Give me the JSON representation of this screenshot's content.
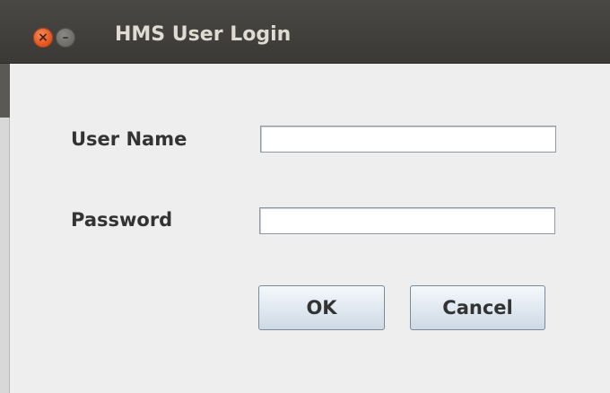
{
  "window": {
    "title": "HMS User Login",
    "close_glyph": "×",
    "minimize_glyph": "–"
  },
  "form": {
    "username_label": "User Name",
    "username_value": "",
    "password_label": "Password",
    "password_value": ""
  },
  "buttons": {
    "ok_label": "OK",
    "cancel_label": "Cancel"
  },
  "colors": {
    "titlebar": "#3f3e3a",
    "close_button": "#e3561f",
    "dialog_background": "#eeeeee"
  }
}
